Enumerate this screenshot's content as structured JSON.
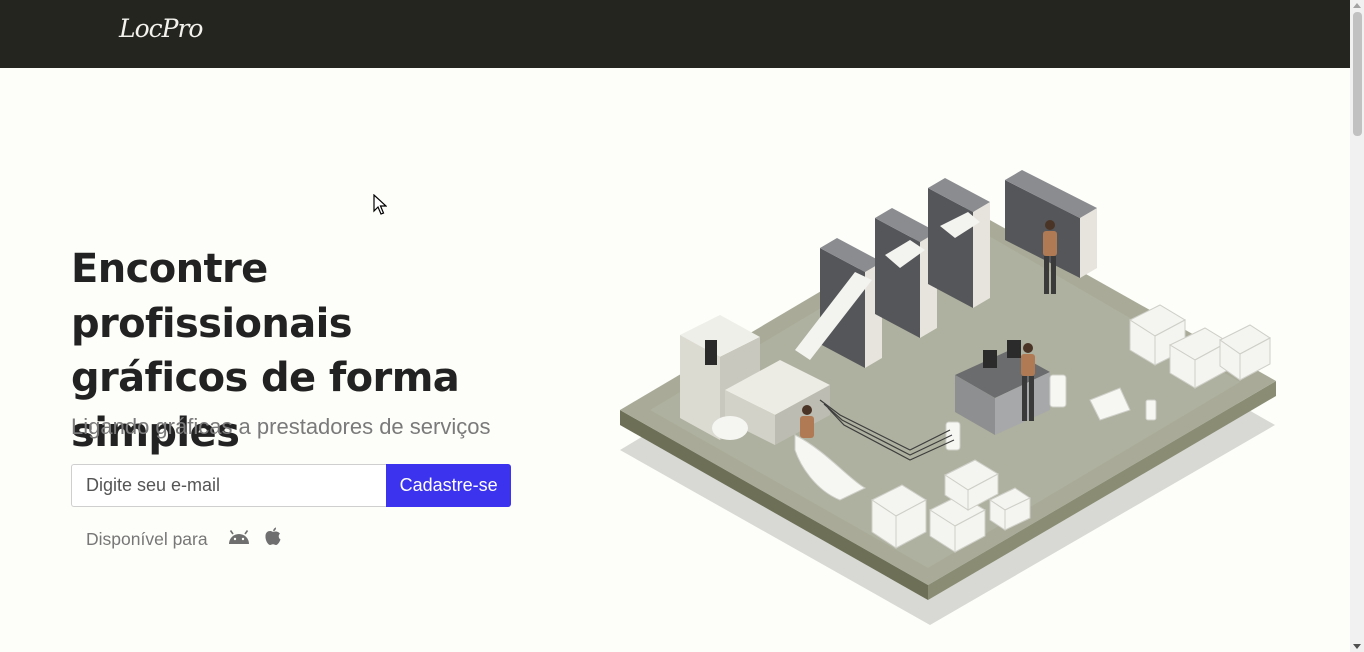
{
  "navbar": {
    "brand": "LocPro"
  },
  "hero": {
    "title": "Encontre profissionais gráficos de forma simples",
    "subtitle": "Ligando gráficas a prestadores de serviços"
  },
  "signup": {
    "email_placeholder": "Digite seu e-mail",
    "submit_label": "Cadastre-se"
  },
  "availability": {
    "label": "Disponível para",
    "platforms": [
      "android-icon",
      "apple-icon"
    ]
  },
  "illustration": {
    "subject": "isometric printing press factory"
  },
  "colors": {
    "navbar": "#252520",
    "accent": "#3b33ee",
    "background": "#fdfdf9"
  }
}
